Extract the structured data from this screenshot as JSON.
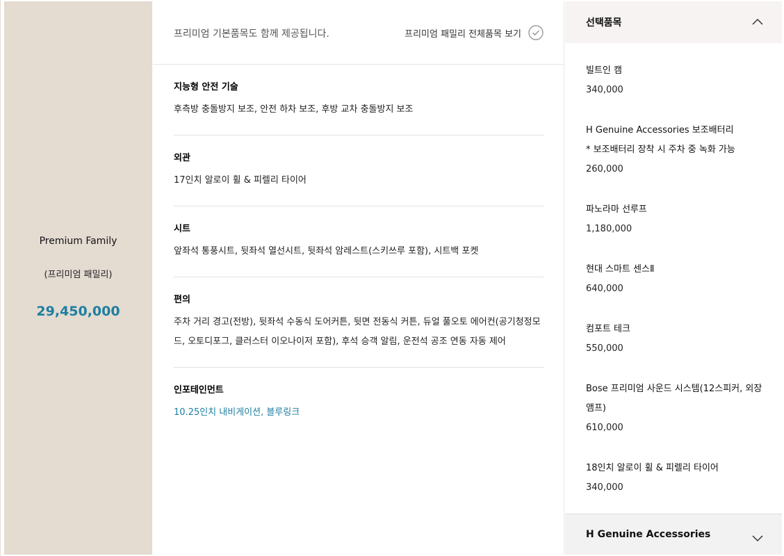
{
  "trim": {
    "name": "Premium Family",
    "sub": "(프리미엄 패밀리)",
    "price": "29,450,000"
  },
  "spec": {
    "note": "프리미엄 기본품목도 함께 제공됩니다.",
    "link_label": "프리미엄 패밀리 전체품목 보기",
    "sections": [
      {
        "title": "지능형 안전 기술",
        "body": "후측방 충돌방지 보조, 안전 하차 보조, 후방 교차 충돌방지 보조"
      },
      {
        "title": "외관",
        "body": "17인치 알로이 휠 & 피렐리 타이어"
      },
      {
        "title": "시트",
        "body": "앞좌석 통풍시트, 뒷좌석 열선시트, 뒷좌석 암레스트(스키쓰루 포함), 시트백 포켓"
      },
      {
        "title": "편의",
        "body": "주차 거리 경고(전방), 뒷좌석 수동식 도어커튼, 뒷면 전동식 커튼, 듀얼 풀오토 에어컨(공기청정모드, 오토디포그, 클러스터 이오나이저 포함), 후석 승객 알림, 운전석 공조 연동 자동 제어"
      },
      {
        "title": "인포테인먼트",
        "body": "10.25인치 내비게이션, 블루링크"
      }
    ]
  },
  "options": {
    "header": "선택품목",
    "items": [
      {
        "name": "빌트인 캠",
        "price": "340,000"
      },
      {
        "name": "H Genuine Accessories 보조배터리",
        "note": "* 보조배터리 장착 시 주차 중 녹화 가능",
        "price": "260,000"
      },
      {
        "name": "파노라마 선루프",
        "price": "1,180,000"
      },
      {
        "name": "현대 스마트 센스Ⅱ",
        "price": "640,000"
      },
      {
        "name": "컴포트 테크",
        "price": "550,000"
      },
      {
        "name": "Bose 프리미엄 사운드 시스템(12스피커, 외장앰프)",
        "price": "610,000"
      },
      {
        "name": "18인치 알로이 휠 & 피렐리 타이어",
        "price": "340,000"
      }
    ],
    "footer": "H Genuine Accessories"
  },
  "icons": {
    "link": "check-circle-icon",
    "header_toggle": "chevron-up-icon",
    "footer_toggle": "chevron-down-icon"
  },
  "colors": {
    "trim_bg": "#e4dbd1",
    "accent_blue": "#1e7fa0",
    "options_header_bg": "#f6f3f2",
    "options_footer_bg": "#f2f2f2"
  }
}
